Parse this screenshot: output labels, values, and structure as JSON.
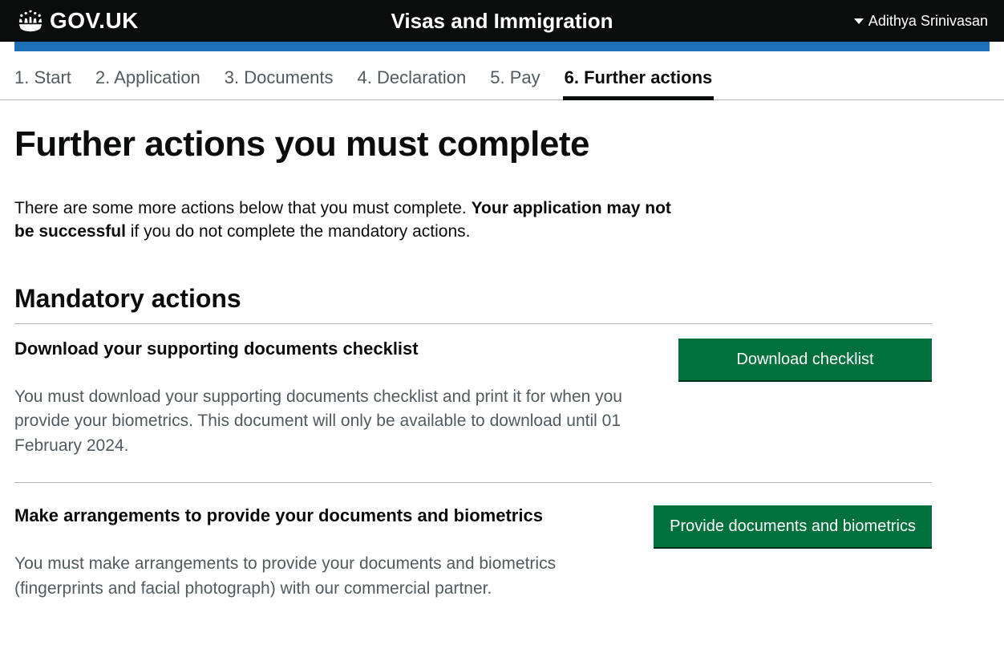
{
  "header": {
    "logo_text": "GOV.UK",
    "service_title": "Visas and Immigration",
    "user_name": "Adithya Srinivasan"
  },
  "tabs": [
    {
      "label": "1. Start",
      "active": false
    },
    {
      "label": "2. Application",
      "active": false
    },
    {
      "label": "3. Documents",
      "active": false
    },
    {
      "label": "4. Declaration",
      "active": false
    },
    {
      "label": "5. Pay",
      "active": false
    },
    {
      "label": "6. Further actions",
      "active": true
    }
  ],
  "page": {
    "title": "Further actions you must complete",
    "intro_pre": "There are some more actions below that you must complete. ",
    "intro_bold": "Your application may not be successful",
    "intro_post": " if you do not complete the mandatory actions."
  },
  "mandatory": {
    "section_title": "Mandatory actions",
    "actions": [
      {
        "heading": "Download your supporting documents checklist",
        "desc": "You must download your supporting documents checklist and print it for when you provide your biometrics. This document will only be available to download until 01 February 2024.",
        "button": "Download checklist"
      },
      {
        "heading": "Make arrangements to provide your documents and biometrics",
        "desc": "You must make arrangements to provide your documents and biometrics (fingerprints and facial photograph) with our commercial partner.",
        "button": "Provide documents and biometrics"
      }
    ]
  }
}
